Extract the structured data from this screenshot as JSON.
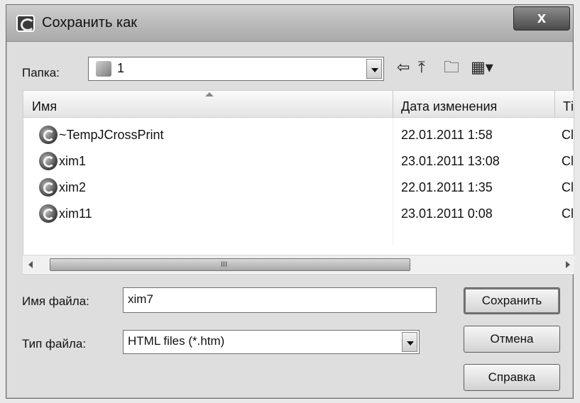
{
  "window": {
    "title": "Сохранить как",
    "close_label": "x"
  },
  "folder": {
    "label": "Папка:",
    "value": "1"
  },
  "toolbar": {
    "back_glyph": "⇦",
    "up_glyph": "⤒",
    "new_folder_glyph": "🗀",
    "view_glyph": "▦▾"
  },
  "list": {
    "columns": [
      "Имя",
      "Дата изменения",
      "Ті"
    ],
    "rows": [
      {
        "name": "~TempJCrossPrint",
        "date": "22.01.2011 1:58",
        "type": "Cl"
      },
      {
        "name": "xim1",
        "date": "23.01.2011 13:08",
        "type": "Cl"
      },
      {
        "name": "xim2",
        "date": "22.01.2011 1:35",
        "type": "Cl"
      },
      {
        "name": "xim11",
        "date": "23.01.2011 0:08",
        "type": "Cl"
      }
    ],
    "scroll_grip": "III"
  },
  "filename": {
    "label": "Имя файла:",
    "value": "xim7"
  },
  "filetype": {
    "label": "Тип файла:",
    "value": "HTML files (*.htm)"
  },
  "buttons": {
    "save": "Сохранить",
    "cancel": "Отмена",
    "help": "Справка"
  }
}
